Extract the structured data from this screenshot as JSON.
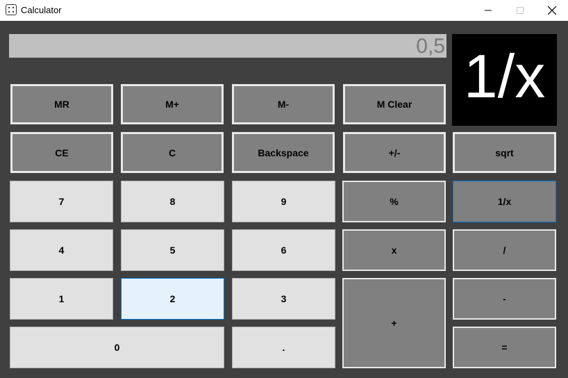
{
  "window": {
    "title": "Calculator",
    "minimize_glyph": "─",
    "maximize_glyph": "☐",
    "close_glyph": "✕"
  },
  "display": {
    "value": "0,5"
  },
  "operation_indicator": {
    "text": "1/x"
  },
  "buttons": {
    "mr": "MR",
    "m_plus": "M+",
    "m_minus": "M-",
    "m_clear": "M Clear",
    "ce": "CE",
    "c": "C",
    "backspace": "Backspace",
    "plus_minus": "+/-",
    "sqrt": "sqrt",
    "seven": "7",
    "eight": "8",
    "nine": "9",
    "percent": "%",
    "reciprocal": "1/x",
    "four": "4",
    "five": "5",
    "six": "6",
    "multiply": "x",
    "divide": "/",
    "one": "1",
    "two": "2",
    "three": "3",
    "add": "+",
    "subtract": "-",
    "zero": "0",
    "decimal": ".",
    "equals": "="
  }
}
